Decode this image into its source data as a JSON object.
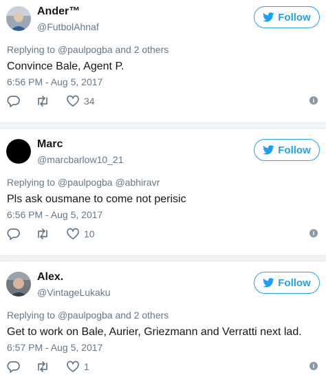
{
  "colors": {
    "accent": "#1da1f2",
    "muted": "#657786",
    "text": "#14171a"
  },
  "tweets": [
    {
      "name": "Ander™",
      "handle": "@FutbolAhnaf",
      "follow_label": "Follow",
      "reply_prefix": "Replying to",
      "reply_mention": "@paulpogba",
      "reply_suffix": "and 2 others",
      "text": "Convince Bale, Agent P.",
      "time": "6:56 PM - Aug 5, 2017",
      "likes": "34",
      "avatar_icon": "avatar-photo-icon"
    },
    {
      "name": "Marc",
      "handle": "@marcbarlow10_21",
      "follow_label": "Follow",
      "reply_prefix": "Replying to",
      "reply_mention": "@paulpogba",
      "reply_suffix": "@abhiravr",
      "text": "Pls ask ousmane to come not perisic",
      "time": "6:56 PM - Aug 5, 2017",
      "likes": "10",
      "avatar_icon": "avatar-black-icon"
    },
    {
      "name": "Alex.",
      "handle": "@VintageLukaku",
      "follow_label": "Follow",
      "reply_prefix": "Replying to",
      "reply_mention": "@paulpogba",
      "reply_suffix": "and 2 others",
      "text": "Get to work on Bale, Aurier, Griezmann and Verratti next lad.",
      "time": "6:57 PM - Aug 5, 2017",
      "likes": "1",
      "avatar_icon": "avatar-photo-icon"
    }
  ]
}
